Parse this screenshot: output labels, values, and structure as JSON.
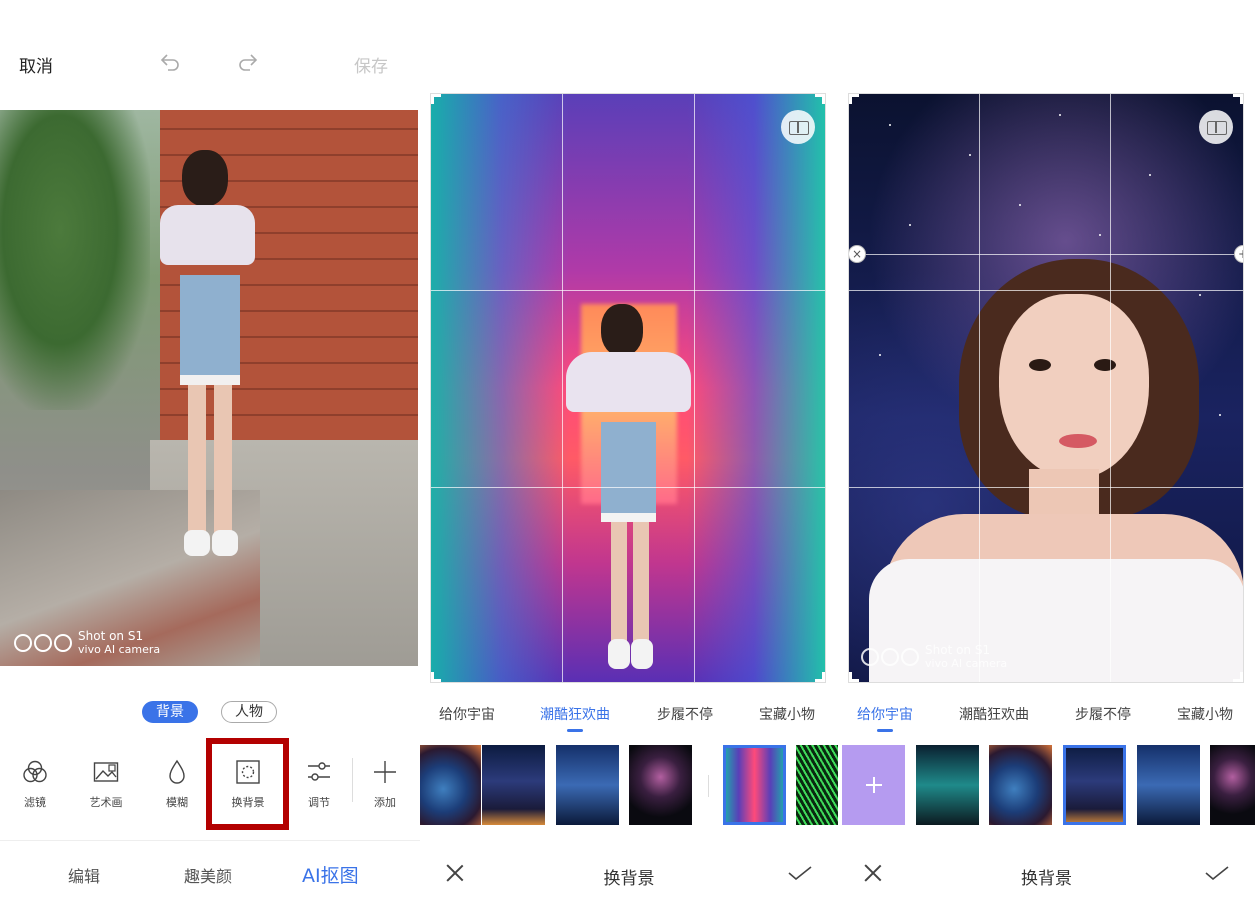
{
  "panel1": {
    "cancel_label": "取消",
    "save_label": "保存",
    "watermark": {
      "line1": "Shot on S1",
      "line2": "vivo AI camera"
    },
    "segments": {
      "background": "背景",
      "person": "人物"
    },
    "tools": [
      "滤镜",
      "艺术画",
      "模糊",
      "换背景",
      "调节",
      "添加"
    ],
    "selected_tool": "换背景",
    "bottom_nav": [
      "编辑",
      "趣美颜",
      "AI抠图"
    ],
    "active_nav": "AI抠图"
  },
  "panel2": {
    "tabs": [
      "给你宇宙",
      "潮酷狂欢曲",
      "步履不停",
      "宝藏小物"
    ],
    "active_tab": "潮酷狂欢曲",
    "title": "换背景"
  },
  "panel3": {
    "tabs": [
      "给你宇宙",
      "潮酷狂欢曲",
      "步履不停",
      "宝藏小物"
    ],
    "active_tab": "给你宇宙",
    "title": "换背景",
    "watermark": {
      "line1": "Shot on S1",
      "line2": "vivo AI camera"
    }
  },
  "colors": {
    "accent": "#3a73e8",
    "highlight_box": "#b30000"
  },
  "icons": [
    "undo-icon",
    "redo-icon",
    "filter-icon",
    "art-icon",
    "blur-icon",
    "change-background-icon",
    "adjust-icon",
    "add-icon",
    "close-icon",
    "check-icon",
    "compare-icon"
  ]
}
